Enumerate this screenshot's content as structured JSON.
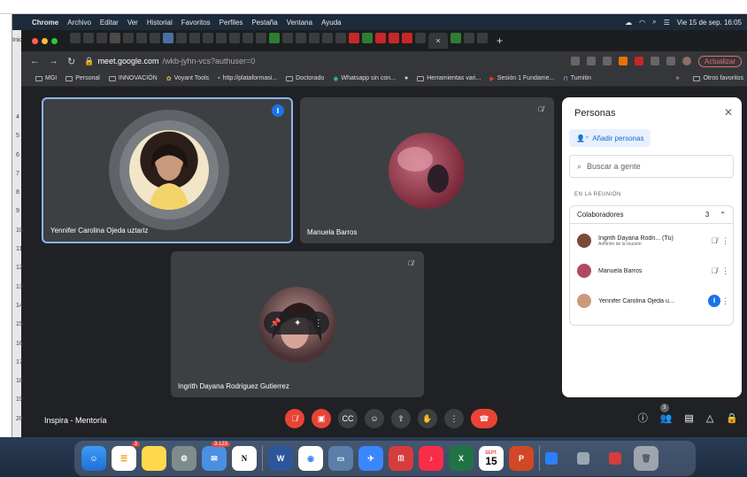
{
  "menubar": {
    "items": [
      "Chrome",
      "Archivo",
      "Editar",
      "Ver",
      "Historial",
      "Favoritos",
      "Perfiles",
      "Pestaña",
      "Ventana",
      "Ayuda"
    ],
    "clock": "Vie 15 de sep.  16:05"
  },
  "left_strip": {
    "numbers": [
      "4",
      "5",
      "6",
      "7",
      "8",
      "9",
      "10",
      "11",
      "12",
      "13",
      "14",
      "15",
      "16",
      "17",
      "18",
      "19",
      "20"
    ],
    "top_label": "Inic"
  },
  "browser": {
    "url_host": "meet.google.com",
    "url_path": "/wkb-jyhn-vcs?authuser=0",
    "update_label": "Actualizar",
    "active_tab_close": "×",
    "bookmarks": [
      "MGI",
      "Personal",
      "INNOVACIÓN",
      "Voyant Tools",
      "http://plataformasi...",
      "Doctorado",
      "Whatsapp sin con...",
      "Herramientas vari...",
      "Sesión 1 Fundame...",
      "Turnitin"
    ],
    "bookmarks_more": "»",
    "bookmarks_other": "Otros favoritos"
  },
  "meet": {
    "participants": [
      {
        "name": "Yennifer Carolina Ojeda uztariz",
        "state": "speaking"
      },
      {
        "name": "Manuela Barros",
        "state": "muted"
      },
      {
        "name": "Ingrith Dayana Rodriguez Gutierrez",
        "state": "muted"
      }
    ],
    "meeting_name": "Inspira - Mentoría",
    "people_count": "3"
  },
  "panel": {
    "title": "Personas",
    "add_label": "Añadir personas",
    "search_placeholder": "Buscar a gente",
    "section": "EN LA REUNIÓN",
    "group_label": "Colaboradores",
    "group_count": "3",
    "people": [
      {
        "name": "Ingrith Dayana Rodri...",
        "you": "(Tú)",
        "sub": "Anfitrión de la reunión"
      },
      {
        "name": "Manuela Barros",
        "you": "",
        "sub": ""
      },
      {
        "name": "Yennifer Carolina Ojeda u...",
        "you": "",
        "sub": ""
      }
    ]
  },
  "dock": {
    "reminders_badge": "3",
    "mail_badge": "3.123",
    "calendar_month": "SEPT.",
    "calendar_day": "15"
  }
}
